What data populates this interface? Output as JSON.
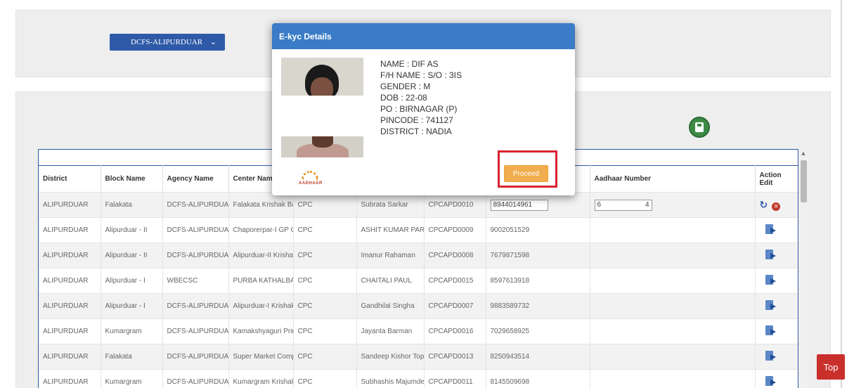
{
  "filter": {
    "agency_select_value": "DCFS-ALIPURDUAR"
  },
  "table": {
    "columns": [
      "District",
      "Block Name",
      "Agency Name",
      "Center Name",
      "",
      "",
      "",
      "",
      "Aadhaar Number",
      "Action Edit"
    ],
    "action_header_line1": "Action",
    "action_header_line2": "Edit",
    "rows": [
      {
        "district": "ALIPURDUAR",
        "block": "Falakata",
        "agency": "DCFS-ALIPURDUAF",
        "center": "Falakata Krishak Baz",
        "type": "CPC",
        "operator": "Subrata Sarkar",
        "code": "CPCAPD0010",
        "mobile": "8944014961",
        "aadhaar": "6",
        "aadhaar_tail": "4"
      },
      {
        "district": "ALIPURDUAR",
        "block": "Alipurduar - II",
        "agency": "DCFS-ALIPURDUAF",
        "center": "Chaporerpar-I GP Of",
        "type": "CPC",
        "operator": "ASHIT KUMAR PAR",
        "code": "CPCAPD0009",
        "mobile": "9002051529",
        "aadhaar": ""
      },
      {
        "district": "ALIPURDUAR",
        "block": "Alipurduar - II",
        "agency": "DCFS-ALIPURDUAF",
        "center": "Alipurduar-II Krishak",
        "type": "CPC",
        "operator": "Imanur Rahaman",
        "code": "CPCAPD0008",
        "mobile": "7679871598",
        "aadhaar": ""
      },
      {
        "district": "ALIPURDUAR",
        "block": "Alipurduar - I",
        "agency": "WBECSC",
        "center": "PURBA KATHALBAF",
        "type": "CPC",
        "operator": "CHAITALI PAUL",
        "code": "CPCAPD0015",
        "mobile": "8597613918",
        "aadhaar": ""
      },
      {
        "district": "ALIPURDUAR",
        "block": "Alipurduar - I",
        "agency": "DCFS-ALIPURDUAF",
        "center": "Alipurduar-I Krishak I",
        "type": "CPC",
        "operator": "Gandhilal Singha",
        "code": "CPCAPD0007",
        "mobile": "9883589732",
        "aadhaar": ""
      },
      {
        "district": "ALIPURDUAR",
        "block": "Kumargram",
        "agency": "DCFS-ALIPURDUAF",
        "center": "Kamakshyaguri Princ",
        "type": "CPC",
        "operator": "Jayanta Barman",
        "code": "CPCAPD0016",
        "mobile": "7029658925",
        "aadhaar": ""
      },
      {
        "district": "ALIPURDUAR",
        "block": "Falakata",
        "agency": "DCFS-ALIPURDUAF",
        "center": "Super Market Compl",
        "type": "CPC",
        "operator": "Sandeep Kishor Top",
        "code": "CPCAPD0013",
        "mobile": "8250943514",
        "aadhaar": ""
      },
      {
        "district": "ALIPURDUAR",
        "block": "Kumargram",
        "agency": "DCFS-ALIPURDUAF",
        "center": "Kumargram Krishak",
        "type": "CPC",
        "operator": "Subhashis Majumde",
        "code": "CPCAPD0011",
        "mobile": "8145509698",
        "aadhaar": ""
      }
    ]
  },
  "modal": {
    "title": "E-kyc Details",
    "name": "NAME : DIF            AS",
    "fh_name": "F/H NAME : S/O :                  3IS",
    "gender": "GENDER : M",
    "dob": "DOB : 22-08",
    "po": "PO : BIRNAGAR (P)",
    "pincode": "PINCODE : 741127",
    "district": "DISTRICT : NADIA",
    "logo_text": "AADHAAR",
    "proceed_label": "Proceed"
  },
  "top_button_label": "Top"
}
